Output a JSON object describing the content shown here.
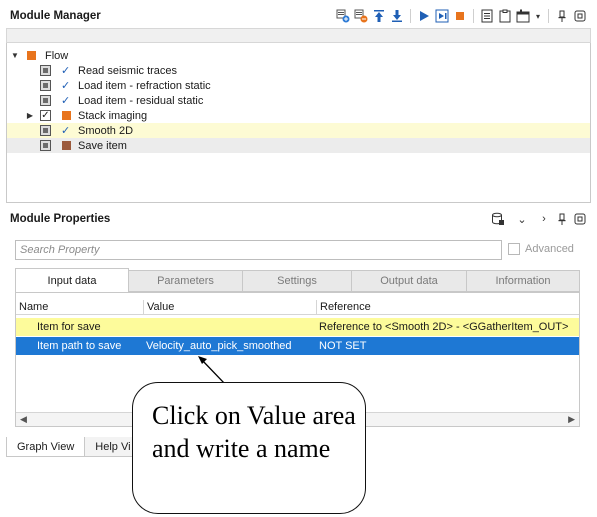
{
  "module_manager": {
    "title": "Module Manager",
    "toolbar_icons": [
      "add-module-icon",
      "remove-module-icon",
      "move-up-icon",
      "move-down-icon",
      "run-icon",
      "run-step-icon",
      "stop-icon",
      "list-icon",
      "clipboard-icon",
      "layout-icon",
      "dropdown-icon",
      "pin-icon",
      "float-icon"
    ],
    "tree": [
      {
        "label": "Flow",
        "level": 0,
        "expanded": true,
        "marker_color": "#e8741d"
      },
      {
        "label": "Read seismic traces",
        "level": 1,
        "checked": true,
        "enabled": true
      },
      {
        "label": "Load item - refraction static",
        "level": 1,
        "checked": true,
        "enabled": true
      },
      {
        "label": "Load item - residual static",
        "level": 1,
        "checked": true,
        "enabled": true
      },
      {
        "label": "Stack imaging",
        "level": 1,
        "collapsed": true,
        "checked": true,
        "marker_color": "#e8741d"
      },
      {
        "label": "Smooth 2D",
        "level": 1,
        "checked": true,
        "enabled": true,
        "highlight": "yellow"
      },
      {
        "label": "Save item",
        "level": 1,
        "checked": false,
        "marker_color": "#9b5a3c",
        "highlight": "grey"
      }
    ]
  },
  "module_properties": {
    "title": "Module Properties",
    "toolbar_icons": [
      "database-icon",
      "chevron-down-icon",
      "chevron-right-icon",
      "pin-icon",
      "float-icon"
    ],
    "search": {
      "placeholder": "Search Property",
      "value": ""
    },
    "advanced_label": "Advanced",
    "tabs": [
      "Input data",
      "Parameters",
      "Settings",
      "Output data",
      "Information"
    ],
    "active_tab": "Input data",
    "columns": [
      "Name",
      "Value",
      "Reference"
    ],
    "rows": [
      {
        "name": "Item for save",
        "value": "",
        "reference": "Reference to <Smooth 2D> - <GGatherItem_OUT>"
      },
      {
        "name": "Item path to save",
        "value": "Velocity_auto_pick_smoothed",
        "reference": "NOT SET"
      }
    ]
  },
  "bottom_tabs": [
    "Graph View",
    "Help Vi"
  ],
  "callout": {
    "text": "Click on Value area and write a name"
  },
  "colors": {
    "orange_marker": "#e8741d",
    "brown_marker": "#9b5a3c",
    "selection": "#1e78d4",
    "row_yellow": "#fdfb9b",
    "check_blue": "#1f5fb5"
  }
}
